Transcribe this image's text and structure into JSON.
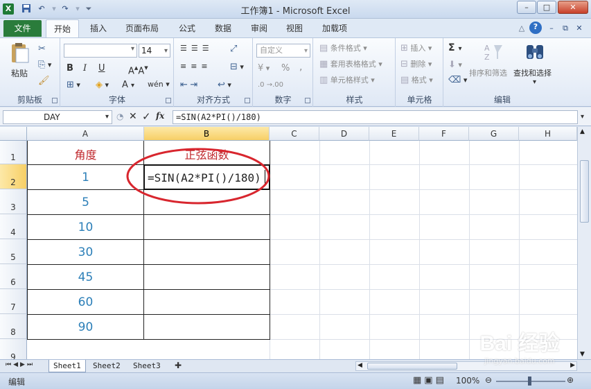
{
  "window": {
    "title": "工作簿1 - Microsoft Excel"
  },
  "qat": {
    "excel_icon": "X",
    "save_icon": "save-icon",
    "undo_icon": "undo-icon",
    "redo_icon": "redo-icon"
  },
  "winctl": {
    "minimize": "–",
    "restore": "□",
    "close": "✕"
  },
  "tabs": [
    "文件",
    "开始",
    "插入",
    "页面布局",
    "公式",
    "数据",
    "审阅",
    "视图",
    "加载项"
  ],
  "ribbon": {
    "clipboard": {
      "label": "剪贴板",
      "paste": "粘贴"
    },
    "font": {
      "label": "字体",
      "size": "14",
      "bold": "B",
      "italic": "I",
      "underline": "U"
    },
    "align": {
      "label": "对齐方式"
    },
    "number": {
      "label": "数字",
      "format": "自定义",
      "percent": "%",
      "comma": ","
    },
    "styles": {
      "label": "样式",
      "cond": "条件格式",
      "table": "套用表格格式",
      "cell": "单元格样式"
    },
    "cells": {
      "label": "单元格",
      "insert": "插入",
      "delete": "删除",
      "format": "格式"
    },
    "edit": {
      "label": "编辑",
      "sort": "排序和筛选",
      "find": "查找和选择",
      "sigma": "Σ"
    }
  },
  "formula_bar": {
    "name_box": "DAY",
    "fx": "fx",
    "formula": "=SIN(A2*PI()/180)"
  },
  "columns": [
    "A",
    "B",
    "C",
    "D",
    "E",
    "F",
    "G",
    "H"
  ],
  "rows": [
    "1",
    "2",
    "3",
    "4",
    "5",
    "6",
    "7",
    "8",
    "9"
  ],
  "cells": {
    "a1": "角度",
    "b1": "正弦函数",
    "a_values": [
      "1",
      "5",
      "10",
      "30",
      "45",
      "60",
      "90"
    ],
    "b2": "=SIN(A2*PI()/180)"
  },
  "sheets": [
    "Sheet1",
    "Sheet2",
    "Sheet3"
  ],
  "status": {
    "mode": "编辑",
    "zoom": "100%"
  },
  "watermark": {
    "text": "Bai 经验",
    "url": "jingyan.baidu.com"
  },
  "colors": {
    "accent": "#2a7c3b",
    "red_mark": "#d8262e",
    "value_blue": "#2c7fb8"
  }
}
